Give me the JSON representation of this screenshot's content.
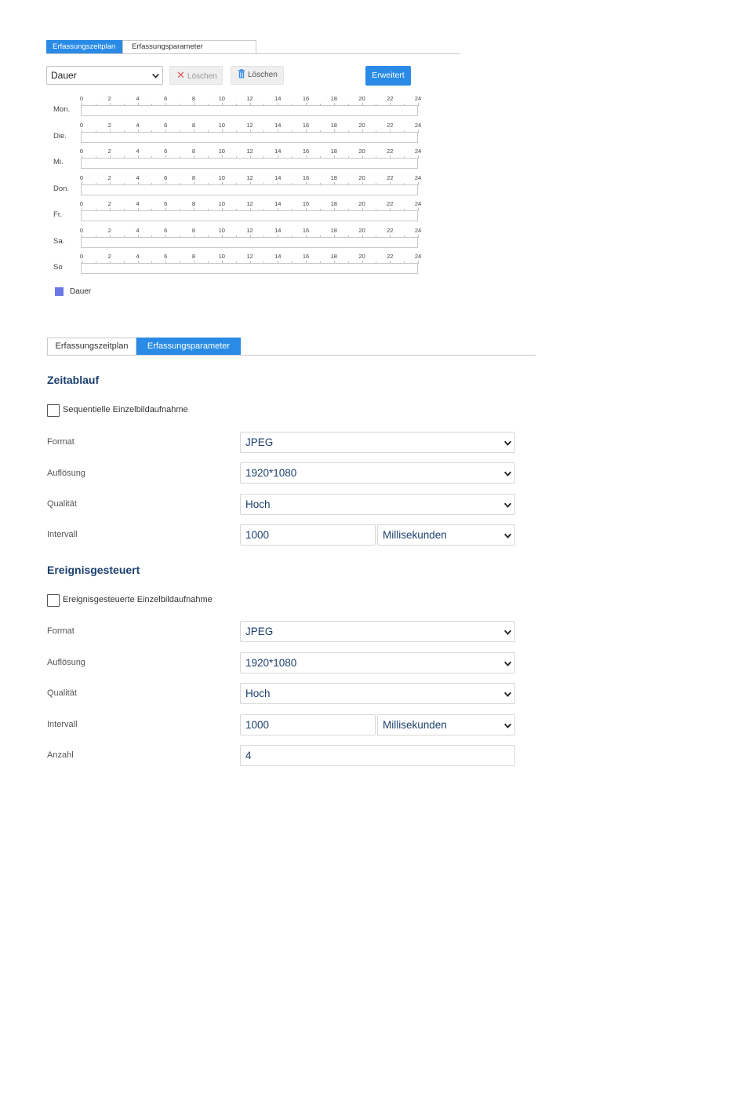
{
  "schedule": {
    "tabs": [
      {
        "label": "Erfassungszeitplan",
        "active": true
      },
      {
        "label": "Erfassungsparameter",
        "active": false
      }
    ],
    "type_select": "Dauer",
    "clear_button": "Löschen",
    "clear_all_button": "Löschen",
    "advanced_button": "Erweitert",
    "hour_ticks": [
      "0",
      "2",
      "4",
      "6",
      "8",
      "10",
      "12",
      "14",
      "16",
      "18",
      "20",
      "22",
      "24"
    ],
    "days": [
      "Mon.",
      "Die.",
      "Mi.",
      "Don.",
      "Fr.",
      "Sa.",
      "So"
    ],
    "legend": {
      "label": "Dauer",
      "color": "#6a78e6"
    }
  },
  "params": {
    "tabs": [
      {
        "label": "Erfassungszeitplan",
        "active": false
      },
      {
        "label": "Erfassungsparameter",
        "active": true
      }
    ],
    "timing": {
      "title": "Zeitablauf",
      "checkbox_label": "Sequentielle Einzelbildaufnahme",
      "checked": false,
      "format_label": "Format",
      "format_value": "JPEG",
      "resolution_label": "Auflösung",
      "resolution_value": "1920*1080",
      "quality_label": "Qualität",
      "quality_value": "Hoch",
      "interval_label": "Intervall",
      "interval_value": "1000",
      "interval_unit": "Millisekunden"
    },
    "event": {
      "title": "Ereignisgesteuert",
      "checkbox_label": "Ereignisgesteuerte Einzelbildaufnahme",
      "checked": false,
      "format_label": "Format",
      "format_value": "JPEG",
      "resolution_label": "Auflösung",
      "resolution_value": "1920*1080",
      "quality_label": "Qualität",
      "quality_value": "Hoch",
      "interval_label": "Intervall",
      "interval_value": "1000",
      "interval_unit": "Millisekunden",
      "count_label": "Anzahl",
      "count_value": "4"
    }
  },
  "colors": {
    "accent": "#2a8be6",
    "heading": "#1c3f6e",
    "delete_icon": "#e25b5b",
    "legend": "#6a78e6"
  }
}
